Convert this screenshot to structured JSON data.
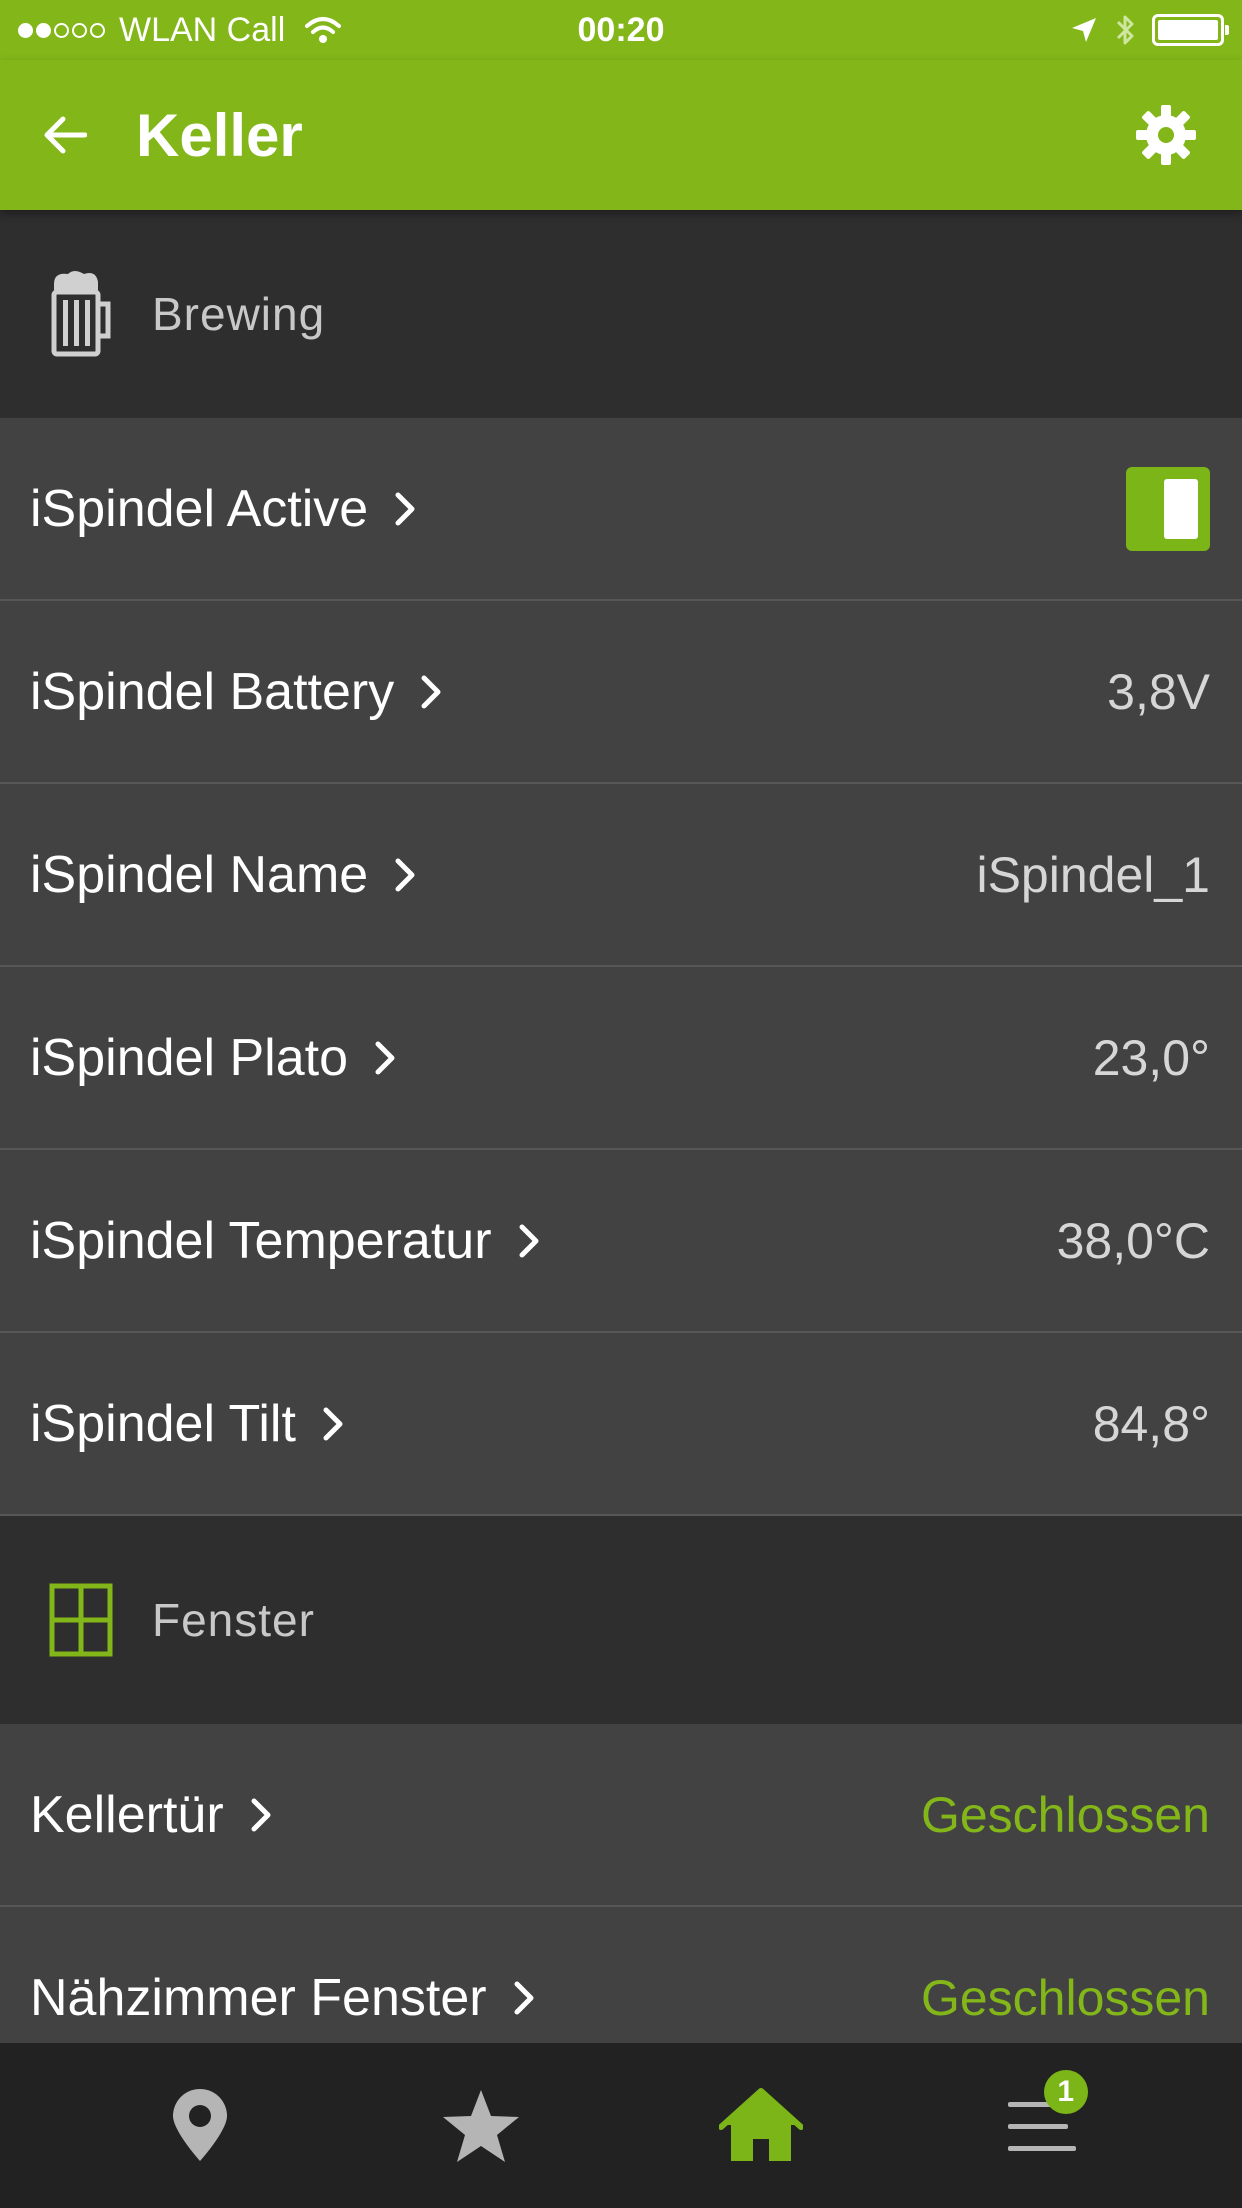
{
  "status_bar": {
    "carrier": "WLAN Call",
    "time": "00:20",
    "signal_bars_filled": 2,
    "signal_bars_total": 5
  },
  "app_bar": {
    "title": "Keller"
  },
  "sections": [
    {
      "title": "Brewing",
      "icon": "beer-mug-icon",
      "rows": [
        {
          "label": "iSpindel Active",
          "type": "toggle",
          "on": true
        },
        {
          "label": "iSpindel Battery",
          "value": "3,8V"
        },
        {
          "label": "iSpindel Name",
          "value": "iSpindel_1"
        },
        {
          "label": "iSpindel Plato",
          "value": "23,0°"
        },
        {
          "label": "iSpindel Temperatur",
          "value": "38,0°C"
        },
        {
          "label": "iSpindel Tilt",
          "value": "84,8°"
        }
      ]
    },
    {
      "title": "Fenster",
      "icon": "window-icon",
      "rows": [
        {
          "label": "Kellertür",
          "value": "Geschlossen"
        },
        {
          "label": "Nähzimmer Fenster",
          "value": "Geschlossen"
        }
      ]
    }
  ],
  "bottom_nav": {
    "items": [
      {
        "icon": "location-pin-icon",
        "active": false
      },
      {
        "icon": "star-icon",
        "active": false
      },
      {
        "icon": "home-icon",
        "active": true
      },
      {
        "icon": "menu-icon",
        "active": false,
        "badge": "1"
      }
    ]
  },
  "colors": {
    "accent": "#83b619",
    "section_bg": "#2e2e2e",
    "row_bg": "#424242",
    "nav_bg": "#222222",
    "inactive_icon": "#b5b5b5"
  }
}
